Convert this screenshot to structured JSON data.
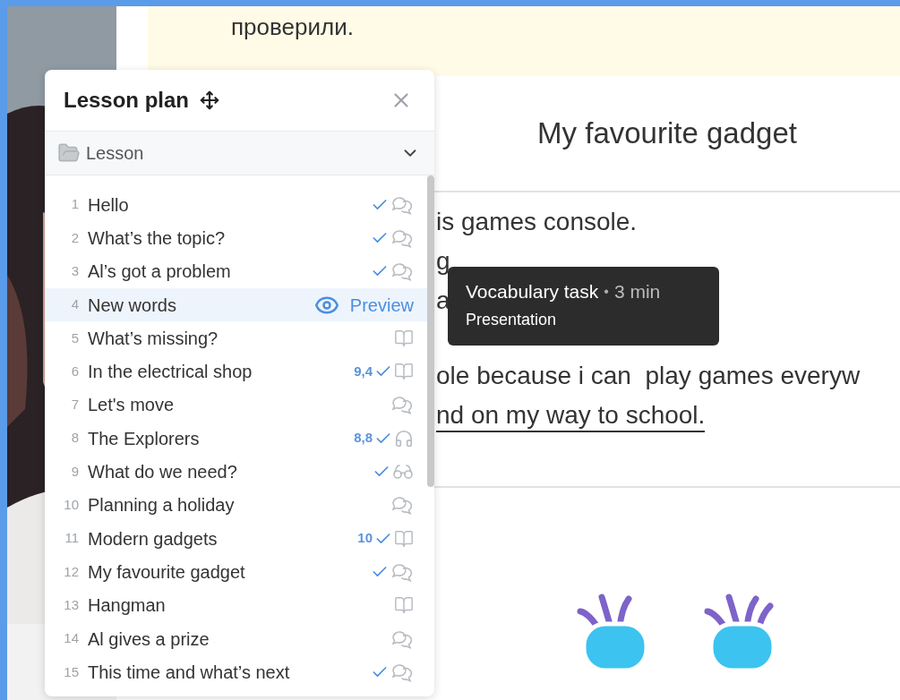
{
  "banner": {
    "text": "проверили."
  },
  "lesson_title": "My favourite gadget",
  "paragraphs": [
    {
      "lines": [
        {
          "text": "is games console.",
          "underlined": false
        },
        {
          "text": "g",
          "underlined": false
        },
        {
          "text": "a",
          "underlined": false
        }
      ]
    },
    {
      "lines": [
        {
          "text": "ole because i can  play games everyw",
          "underlined": false
        },
        {
          "text": "nd on my way to school.",
          "underlined": true
        }
      ]
    }
  ],
  "lesson_plan": {
    "title": "Lesson plan",
    "section": {
      "label": "Lesson",
      "expanded": true
    },
    "items": [
      {
        "number": "1",
        "title": "Hello",
        "done": true,
        "kind": "chat",
        "selected": false
      },
      {
        "number": "2",
        "title": "What’s the topic?",
        "done": true,
        "kind": "chat",
        "selected": false
      },
      {
        "number": "3",
        "title": "Al’s got a problem",
        "done": true,
        "kind": "chat",
        "selected": false
      },
      {
        "number": "4",
        "title": "New words",
        "done": false,
        "kind": "preview",
        "preview_label": "Preview",
        "selected": true
      },
      {
        "number": "5",
        "title": "What’s missing?",
        "done": false,
        "kind": "book",
        "selected": false
      },
      {
        "number": "6",
        "title": "In the electrical shop",
        "score": "9,4",
        "done": true,
        "kind": "book",
        "selected": false
      },
      {
        "number": "7",
        "title": "Let's move",
        "done": false,
        "kind": "chat",
        "selected": false
      },
      {
        "number": "8",
        "title": "The Explorers",
        "score": "8,8",
        "done": true,
        "kind": "headphones",
        "selected": false
      },
      {
        "number": "9",
        "title": "What do we need?",
        "done": true,
        "kind": "glasses",
        "selected": false
      },
      {
        "number": "10",
        "title": "Planning a holiday",
        "done": false,
        "kind": "chat",
        "selected": false
      },
      {
        "number": "11",
        "title": "Modern gadgets",
        "score": "10",
        "done": true,
        "kind": "book",
        "selected": false
      },
      {
        "number": "12",
        "title": "My favourite gadget",
        "done": true,
        "kind": "chat",
        "selected": false
      },
      {
        "number": "13",
        "title": "Hangman",
        "done": false,
        "kind": "book",
        "selected": false
      },
      {
        "number": "14",
        "title": "Al gives a prize",
        "done": false,
        "kind": "chat",
        "selected": false
      },
      {
        "number": "15",
        "title": "This time and what’s next",
        "done": true,
        "kind": "chat",
        "selected": false
      }
    ]
  },
  "tooltip": {
    "title": "Vocabulary task",
    "separator": "•",
    "duration": "3 min",
    "subtitle": "Presentation"
  }
}
